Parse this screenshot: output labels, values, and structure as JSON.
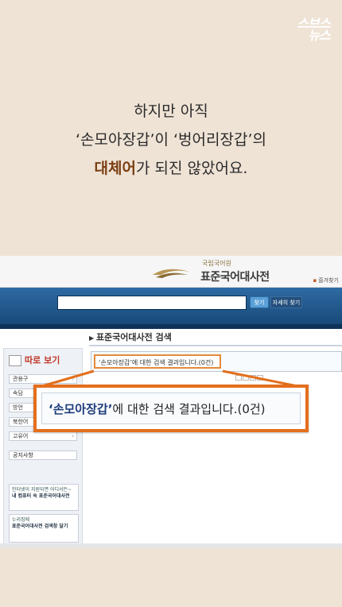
{
  "brand": {
    "logo_line1": "스브스",
    "logo_line2": "뉴스"
  },
  "caption": {
    "line1": "하지만 아직",
    "line2": "‘손모아장갑’이 ‘벙어리장갑’의",
    "line3_highlight": "대체어",
    "line3_rest": "가 되진 않았어요."
  },
  "screenshot": {
    "site_small": "국립국어원",
    "site_title": "표준국어대사전",
    "bookmark": "즐겨찾기",
    "search_value": "",
    "search_button": "찾기",
    "detail_button": "자세히 찾기",
    "section_title": "표준국어대사전 검색",
    "sidebar": {
      "head": "따로 보기",
      "items": [
        "관용구",
        "속담",
        "방언",
        "북한어",
        "고유어"
      ],
      "notice": "공지사항",
      "promo1_title": "인터넷이 지원되면 어디서든~",
      "promo1_text": "내 컴퓨터 속 표준국어대사전",
      "promo2_title": "누리집에",
      "promo2_text": "표준국어대사전 검색창 달기"
    },
    "result_small": "‘손모아장갑’에 대한 검색 결과입니다.(0건)",
    "callout_term": "‘손모아장갑’",
    "callout_rest": "에 대한 검색 결과입니다.(0건)"
  },
  "colors": {
    "accent_orange": "#e46f1d",
    "highlight_brown": "#7a3e12",
    "band_blue": "#245b91",
    "background": "#efe3d6"
  }
}
